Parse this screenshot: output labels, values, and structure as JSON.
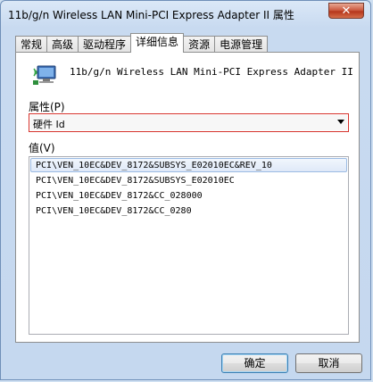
{
  "window": {
    "title": "11b/g/n  Wireless LAN Mini-PCI Express Adapter II 属性",
    "close_label": "✕"
  },
  "tabs": [
    {
      "label": "常规"
    },
    {
      "label": "高级"
    },
    {
      "label": "驱动程序"
    },
    {
      "label": "详细信息",
      "active": true
    },
    {
      "label": "资源"
    },
    {
      "label": "电源管理"
    }
  ],
  "device": {
    "name": "11b/g/n  Wireless LAN Mini-PCI Express Adapter II",
    "icon": "network-adapter-icon"
  },
  "property": {
    "label": "属性(P)",
    "selected": "硬件 Id"
  },
  "value": {
    "label": "值(V)",
    "items": [
      "PCI\\VEN_10EC&DEV_8172&SUBSYS_E02010EC&REV_10",
      "PCI\\VEN_10EC&DEV_8172&SUBSYS_E02010EC",
      "PCI\\VEN_10EC&DEV_8172&CC_028000",
      "PCI\\VEN_10EC&DEV_8172&CC_0280"
    ]
  },
  "buttons": {
    "ok": "确定",
    "cancel": "取消"
  },
  "colors": {
    "selection_border": "#d6332c",
    "close_button": "#c9543a"
  }
}
